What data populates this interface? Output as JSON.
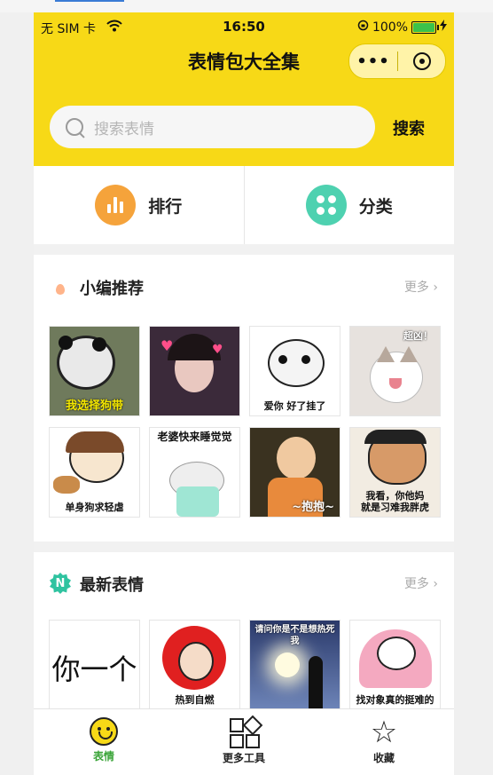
{
  "status_bar": {
    "carrier": "无 SIM 卡",
    "time": "16:50",
    "battery": "100%",
    "battery_level": 1.0
  },
  "header": {
    "title": "表情包大全集",
    "menu_glyph": "•••"
  },
  "search": {
    "placeholder": "搜索表情",
    "button_label": "搜索"
  },
  "quick_links": [
    {
      "label": "排行",
      "icon": "bar-chart-icon",
      "color": "#f5a33b"
    },
    {
      "label": "分类",
      "icon": "grid-dots-icon",
      "color": "#4ed1b0"
    }
  ],
  "sections": {
    "recommended": {
      "title": "小编推荐",
      "more": "更多",
      "items": [
        {
          "caption": "我选择狗带"
        },
        {
          "caption": ""
        },
        {
          "caption": "爱你  好了挂了"
        },
        {
          "caption": "超凶！"
        },
        {
          "caption": "单身狗求轻虐"
        },
        {
          "caption": "老婆快来睡觉觉"
        },
        {
          "caption": "~抱抱~"
        },
        {
          "caption": "我看，你他妈\n就是习难我胖虎"
        }
      ]
    },
    "latest": {
      "title": "最新表情",
      "more": "更多",
      "items": [
        {
          "caption": "你一个"
        },
        {
          "caption": "热到自燃"
        },
        {
          "caption": "请问你是不是想热死我"
        },
        {
          "caption": "找对象真的挺难的"
        }
      ]
    }
  },
  "tabbar": [
    {
      "label": "表情",
      "icon": "smile-face-icon",
      "active": true
    },
    {
      "label": "更多工具",
      "icon": "tools-grid-icon",
      "active": false
    },
    {
      "label": "收藏",
      "icon": "star-icon",
      "active": false
    }
  ],
  "colors": {
    "brand_yellow": "#f7d917",
    "active_tab": "#3aa438"
  }
}
